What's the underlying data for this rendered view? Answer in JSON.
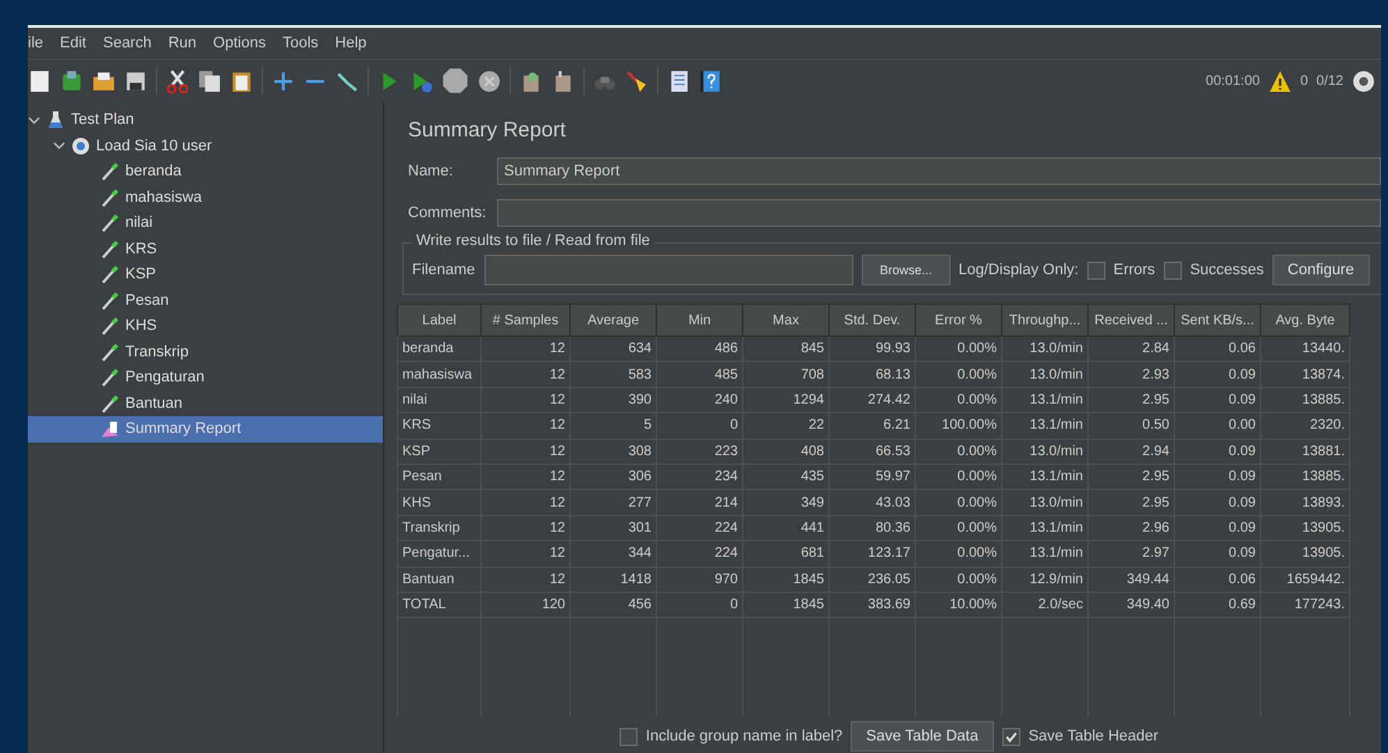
{
  "menu": [
    "ile",
    "Edit",
    "Search",
    "Run",
    "Options",
    "Tools",
    "Help"
  ],
  "status": {
    "time": "00:01:00",
    "warnings": "0",
    "threads": "0/12"
  },
  "tree": [
    {
      "label": "Test Plan",
      "kind": "plan",
      "expanded": true,
      "selected": false,
      "children": [
        {
          "label": "Load Sia 10 user",
          "kind": "group",
          "expanded": true,
          "selected": false,
          "children": [
            {
              "label": "beranda",
              "kind": "sampler",
              "selected": false
            },
            {
              "label": "mahasiswa",
              "kind": "sampler",
              "selected": false
            },
            {
              "label": "nilai",
              "kind": "sampler",
              "selected": false
            },
            {
              "label": "KRS",
              "kind": "sampler",
              "selected": false
            },
            {
              "label": "KSP",
              "kind": "sampler",
              "selected": false
            },
            {
              "label": "Pesan",
              "kind": "sampler",
              "selected": false
            },
            {
              "label": "KHS",
              "kind": "sampler",
              "selected": false
            },
            {
              "label": "Transkrip",
              "kind": "sampler",
              "selected": false
            },
            {
              "label": "Pengaturan",
              "kind": "sampler",
              "selected": false
            },
            {
              "label": "Bantuan",
              "kind": "sampler",
              "selected": false
            },
            {
              "label": "Summary Report",
              "kind": "listener",
              "selected": true
            }
          ]
        }
      ]
    }
  ],
  "panel": {
    "title": "Summary Report",
    "name_label": "Name:",
    "name_value": "Summary Report",
    "comments_label": "Comments:",
    "file_group": "Write results to file / Read from file",
    "filename_label": "Filename",
    "browse": "Browse...",
    "log_label": "Log/Display Only:",
    "errors": {
      "label": "Errors",
      "checked": false
    },
    "successes": {
      "label": "Successes",
      "checked": false
    },
    "configure": "Configure"
  },
  "table": {
    "columns": [
      "Label",
      "# Samples",
      "Average",
      "Min",
      "Max",
      "Std. Dev.",
      "Error %",
      "Throughp...",
      "Received ...",
      "Sent KB/s...",
      "Avg. Byte"
    ],
    "rows": [
      [
        "beranda",
        "12",
        "634",
        "486",
        "845",
        "99.93",
        "0.00%",
        "13.0/min",
        "2.84",
        "0.06",
        "13440."
      ],
      [
        "mahasiswa",
        "12",
        "583",
        "485",
        "708",
        "68.13",
        "0.00%",
        "13.0/min",
        "2.93",
        "0.09",
        "13874."
      ],
      [
        "nilai",
        "12",
        "390",
        "240",
        "1294",
        "274.42",
        "0.00%",
        "13.1/min",
        "2.95",
        "0.09",
        "13885."
      ],
      [
        "KRS",
        "12",
        "5",
        "0",
        "22",
        "6.21",
        "100.00%",
        "13.1/min",
        "0.50",
        "0.00",
        "2320."
      ],
      [
        "KSP",
        "12",
        "308",
        "223",
        "408",
        "66.53",
        "0.00%",
        "13.0/min",
        "2.94",
        "0.09",
        "13881."
      ],
      [
        "Pesan",
        "12",
        "306",
        "234",
        "435",
        "59.97",
        "0.00%",
        "13.1/min",
        "2.95",
        "0.09",
        "13885."
      ],
      [
        "KHS",
        "12",
        "277",
        "214",
        "349",
        "43.03",
        "0.00%",
        "13.0/min",
        "2.95",
        "0.09",
        "13893."
      ],
      [
        "Transkrip",
        "12",
        "301",
        "224",
        "441",
        "80.36",
        "0.00%",
        "13.1/min",
        "2.96",
        "0.09",
        "13905."
      ],
      [
        "Pengatur...",
        "12",
        "344",
        "224",
        "681",
        "123.17",
        "0.00%",
        "13.1/min",
        "2.97",
        "0.09",
        "13905."
      ],
      [
        "Bantuan",
        "12",
        "1418",
        "970",
        "1845",
        "236.05",
        "0.00%",
        "12.9/min",
        "349.44",
        "0.06",
        "1659442."
      ],
      [
        "TOTAL",
        "120",
        "456",
        "0",
        "1845",
        "383.69",
        "10.00%",
        "2.0/sec",
        "349.40",
        "0.69",
        "177243."
      ]
    ]
  },
  "footer": {
    "include_group": {
      "label": "Include group name in label?",
      "checked": false
    },
    "save_data": "Save Table Data",
    "save_header": {
      "label": "Save Table Header",
      "checked": true
    }
  }
}
